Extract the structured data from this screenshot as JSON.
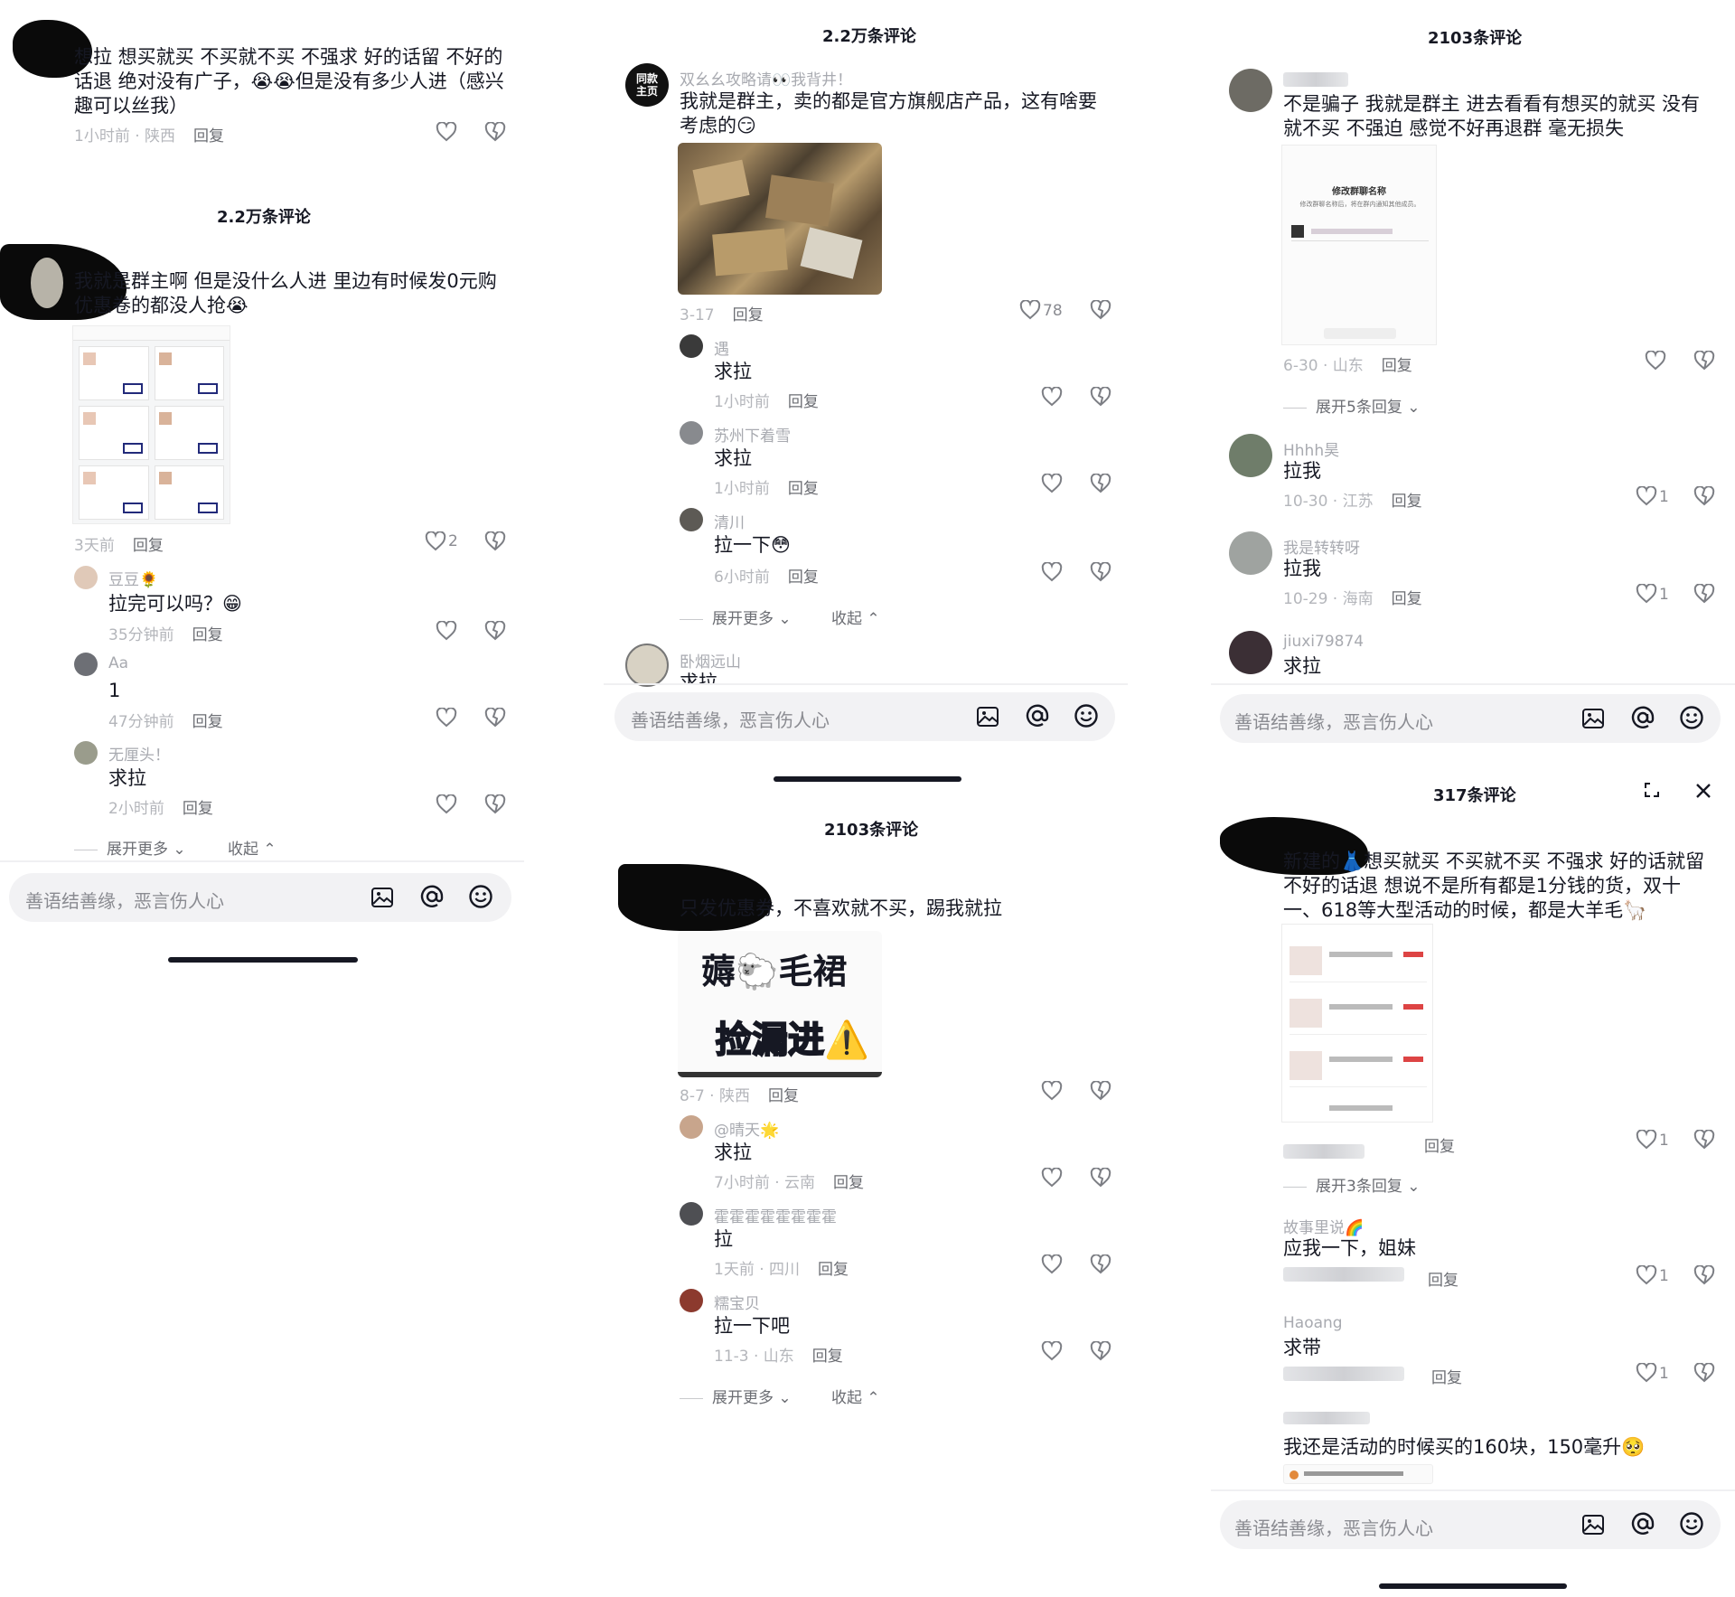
{
  "p1": {
    "top_comment": {
      "text": "想拉 想买就买 不买就不买 不强求 好的话留 不好的话退 绝对没有广子，😭😭但是没有多少人进（感兴趣可以丝我）",
      "time": "1小时前 · 陕西",
      "reply": "回复"
    },
    "header": "2.2万条评论",
    "main_comment": {
      "text": "我就是群主啊 但是没什么人进 里边有时候发0元购优惠卷的都没人抢😭",
      "time": "3天前",
      "reply": "回复",
      "likes": "2"
    },
    "replies": [
      {
        "name": "豆豆🌻",
        "text": "拉完可以吗？😁",
        "time": "35分钟前",
        "reply": "回复"
      },
      {
        "name": "Aa",
        "text": "1",
        "time": "47分钟前",
        "reply": "回复"
      },
      {
        "name": "无厘头！",
        "text": "求拉",
        "time": "2小时前",
        "reply": "回复"
      }
    ],
    "more": "展开更多",
    "collapse": "收起",
    "input_placeholder": "善语结善缘，恶言伤人心"
  },
  "p2": {
    "header": "2.2万条评论",
    "main_comment": {
      "name": "双幺幺攻略请👀我背井！",
      "avatar_label": "同款主页",
      "text": "我就是群主，卖的都是官方旗舰店产品，这有啥要考虑的😏",
      "time": "3-17",
      "reply": "回复",
      "likes": "78"
    },
    "replies": [
      {
        "name": "遇",
        "text": "求拉",
        "time": "1小时前",
        "reply": "回复"
      },
      {
        "name": "苏州下着雪",
        "text": "求拉",
        "time": "1小时前",
        "reply": "回复"
      },
      {
        "name": "清川",
        "text": "拉一下😳",
        "time": "6小时前",
        "reply": "回复"
      }
    ],
    "more": "展开更多",
    "collapse": "收起",
    "peek_name": "卧烟远山",
    "peek_text": "求拉",
    "input_placeholder": "善语结善缘，恶言伤人心"
  },
  "p3": {
    "header": "2103条评论",
    "main_comment": {
      "text": "只发优惠券，不喜欢就不买，踢我就拉",
      "image_line1": "薅🐑毛裙",
      "image_line2": "捡漏进⚠️",
      "time": "8-7 · 陕西",
      "reply": "回复"
    },
    "replies": [
      {
        "name": "@晴天🌟",
        "text": "求拉",
        "time": "7小时前 · 云南",
        "reply": "回复"
      },
      {
        "name": "霍霍霍霍霍霍霍霍",
        "text": "拉",
        "time": "1天前 · 四川",
        "reply": "回复"
      },
      {
        "name": "糯宝贝",
        "text": "拉一下吧",
        "time": "11-3 · 山东",
        "reply": "回复"
      }
    ],
    "more": "展开更多",
    "collapse": "收起"
  },
  "p4": {
    "header": "2103条评论",
    "main_comment": {
      "text": "不是骗子 我就是群主 进去看看有想买的就买 没有就不买 不强迫 感觉不好再退群 毫无损失",
      "shot_title": "修改群聊名称",
      "shot_sub": "修改群聊名称后，将在群内通知其他成员。",
      "time": "6-30 · 山东",
      "reply": "回复"
    },
    "expand": "展开5条回复",
    "replies": [
      {
        "name": "Hhhh昊",
        "text": "拉我",
        "time": "10-30 · 江苏",
        "reply": "回复",
        "likes": "1"
      },
      {
        "name": "我是转转呀",
        "text": "拉我",
        "time": "10-29 · 海南",
        "reply": "回复",
        "likes": "1"
      },
      {
        "name": "jiuxi79874",
        "text": "求拉"
      }
    ],
    "input_placeholder": "善语结善缘，恶言伤人心"
  },
  "p5": {
    "header": "317条评论",
    "main_comment": {
      "text": "新建的👗想买就买 不买就不买 不强求 好的话就留 不好的话退 想说不是所有都是1分钱的货，双十一、618等大型活动的时候，都是大羊毛🦙",
      "reply": "回复",
      "likes": "1"
    },
    "expand": "展开3条回复",
    "replies": [
      {
        "name": "故事里说🌈",
        "text": "应我一下，姐妹",
        "reply": "回复",
        "likes": "1"
      },
      {
        "name": "Haoang",
        "text": "求带",
        "reply": "回复",
        "likes": "1"
      },
      {
        "name": "",
        "text": "我还是活动的时候买的160块，150毫升🥺"
      }
    ],
    "input_placeholder": "善语结善缘，恶言伤人心"
  },
  "colors": {
    "text": "#161823",
    "muted": "#b4b6bb",
    "input_bg": "#f2f2f4"
  }
}
